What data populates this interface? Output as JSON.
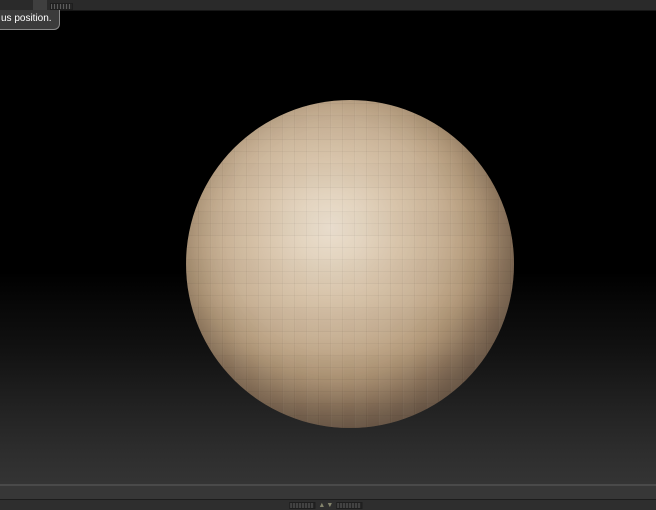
{
  "tooltip": {
    "text": "us position."
  },
  "bottom_divider": {
    "up_arrow": "▲",
    "down_arrow": "▼"
  },
  "colors": {
    "top_bar": "#2a2a2a",
    "canvas_top": "#000000",
    "canvas_bottom": "#343434",
    "tray": "#373737",
    "bottom_bar": "#2e2e2e",
    "tooltip_bg": "#3b3b3b",
    "sphere_highlight": "#ebdfcf",
    "sphere_mid": "#c8b195",
    "sphere_edge": "#483c31",
    "arrow": "#85856d"
  }
}
